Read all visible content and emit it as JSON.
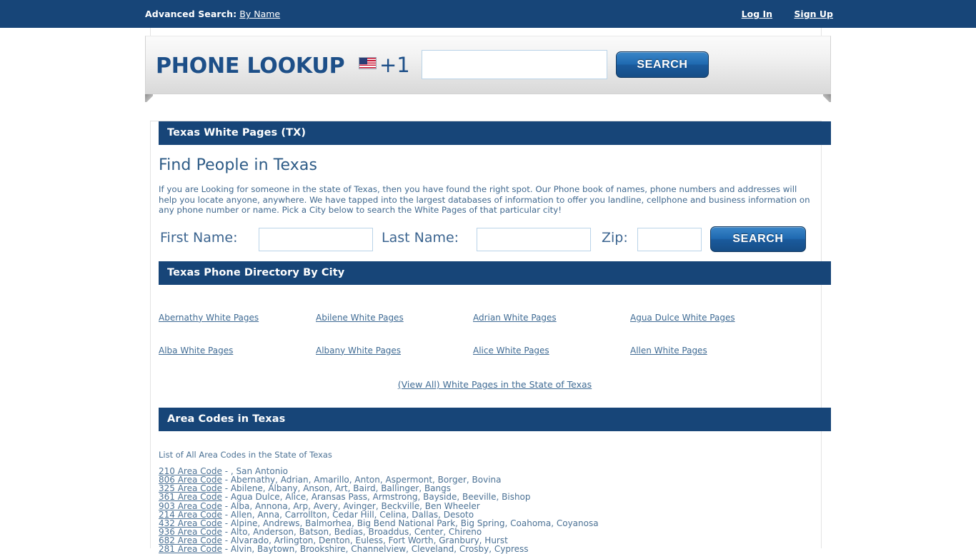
{
  "topbar": {
    "advanced_search_label": "Advanced Search:",
    "by_name_link": "By Name",
    "login_link": "Log In",
    "signup_link": "Sign Up"
  },
  "header": {
    "brand": "PHONE LOOKUP",
    "flag_icon": "us-flag-icon",
    "country_code": "+1",
    "phone_input_value": "",
    "phone_input_placeholder": "",
    "search_button": "SEARCH"
  },
  "page": {
    "section_title": "Texas White Pages (TX)",
    "heading": "Find People in Texas",
    "intro": "If you are Looking for someone in the state of Texas, then you have found the right spot. Our Phone book of names, phone numbers and addresses will help you locate anyone, anywhere. We have tapped into the largest databases of information to offer you landline, cellphone and business information on any phone number or name. Pick a City below to search the White Pages of that particular city!"
  },
  "name_form": {
    "first_name_label": "First Name:",
    "first_name_value": "",
    "last_name_label": "Last Name:",
    "last_name_value": "",
    "zip_label": "Zip:",
    "zip_value": "",
    "search_button": "SEARCH"
  },
  "city_directory": {
    "title": "Texas Phone Directory By City",
    "cities": [
      "Abernathy White Pages",
      "Abilene White Pages",
      "Adrian White Pages",
      "Agua Dulce White Pages",
      "Alba White Pages",
      "Albany White Pages",
      "Alice White Pages",
      "Allen White Pages"
    ],
    "view_all": "(View All) White Pages in the State of Texas"
  },
  "area_codes": {
    "title": "Area Codes in Texas",
    "note": "List of All Area Codes in the State of Texas",
    "rows": [
      {
        "code": "210 Area Code",
        "sep": " - ",
        "cities": ", San Antonio"
      },
      {
        "code": "806 Area Code",
        "sep": " - ",
        "cities": "Abernathy, Adrian, Amarillo, Anton, Aspermont, Borger, Bovina"
      },
      {
        "code": "325 Area Code",
        "sep": " - ",
        "cities": "Abilene, Albany, Anson, Art, Baird, Ballinger, Bangs"
      },
      {
        "code": "361 Area Code",
        "sep": " - ",
        "cities": "Agua Dulce, Alice, Aransas Pass, Armstrong, Bayside, Beeville, Bishop"
      },
      {
        "code": "903 Area Code",
        "sep": " - ",
        "cities": "Alba, Annona, Arp, Avery, Avinger, Beckville, Ben Wheeler"
      },
      {
        "code": "214 Area Code",
        "sep": " - ",
        "cities": "Allen, Anna, Carrollton, Cedar Hill, Celina, Dallas, Desoto"
      },
      {
        "code": "432 Area Code",
        "sep": " - ",
        "cities": "Alpine, Andrews, Balmorhea, Big Bend National Park, Big Spring, Coahoma, Coyanosa"
      },
      {
        "code": "936 Area Code",
        "sep": " - ",
        "cities": "Alto, Anderson, Batson, Bedias, Broaddus, Center, Chireno"
      },
      {
        "code": "682 Area Code",
        "sep": " - ",
        "cities": "Alvarado, Arlington, Denton, Euless, Fort Worth, Granbury, Hurst"
      },
      {
        "code": "281 Area Code",
        "sep": " - ",
        "cities": "Alvin, Baytown, Brookshire, Channelview, Cleveland, Crosby, Cypress"
      }
    ]
  },
  "colors": {
    "brand_blue": "#174578",
    "link_blue": "#3f6b94",
    "text_blue": "#41698f"
  }
}
